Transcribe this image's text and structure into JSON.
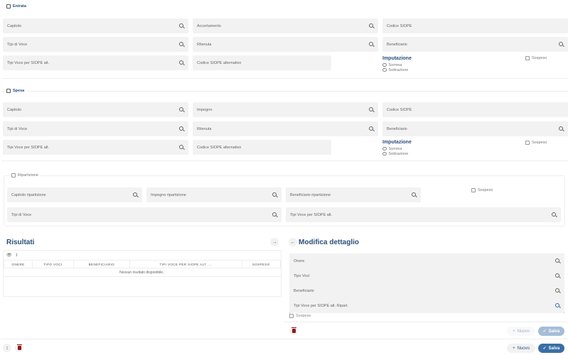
{
  "entrata": {
    "label": "Entrata",
    "fields": [
      "Capitolo",
      "Accertamento",
      "Codice SIOPE",
      "Tipi di Voce",
      "Ritenuta",
      "Beneficiario",
      "Tipi Voce per SIOPE alt.",
      "Codice SIOPE alternativo"
    ],
    "imputazione": "Imputazione",
    "somma": "Somma",
    "sottrazione": "Sottrazione",
    "sospeso": "Sospeso"
  },
  "spesa": {
    "label": "Spesa",
    "fields": [
      "Capitolo",
      "Impegno",
      "Codice SIOPE",
      "Tipi di Voce",
      "Ritenuta",
      "Beneficiario",
      "Tipi Voce per SIOPE alt.",
      "Codice SIOPE alternativo"
    ],
    "imputazione": "Imputazione",
    "somma": "Somma",
    "sottrazione": "Sottrazione",
    "sospeso": "Sospeso"
  },
  "ripartizione": {
    "label": "Ripartizione",
    "fields": [
      "Capitolo ripartizione",
      "Impegno ripartizione",
      "Beneficiario ripartizione",
      "Tipi di Voce",
      "Tipi Voce per SIOPE alt."
    ],
    "sospeso": "Sospeso"
  },
  "risultati": {
    "title": "Risultati",
    "toolbar_count": "I",
    "columns": [
      "ONERE",
      "TIPO VOCI",
      "BENEFICIARIO",
      "TIPI VOCE PER SIOPE ALT. ...",
      "SOSPESO"
    ],
    "empty": "Nessun risultato disponibile.."
  },
  "dettaglio": {
    "title": "Modifica dettaglio",
    "fields": [
      "Onere",
      "Tipo Voci",
      "Beneficiario",
      "Tipi Voce per SIOPE alt. Ripart."
    ],
    "sospeso": "Sospeso",
    "nuovo": "Nuovo",
    "salva": "Salva"
  },
  "footer": {
    "sort": "↕",
    "nuovo": "Nuovo",
    "salva": "Salva"
  }
}
